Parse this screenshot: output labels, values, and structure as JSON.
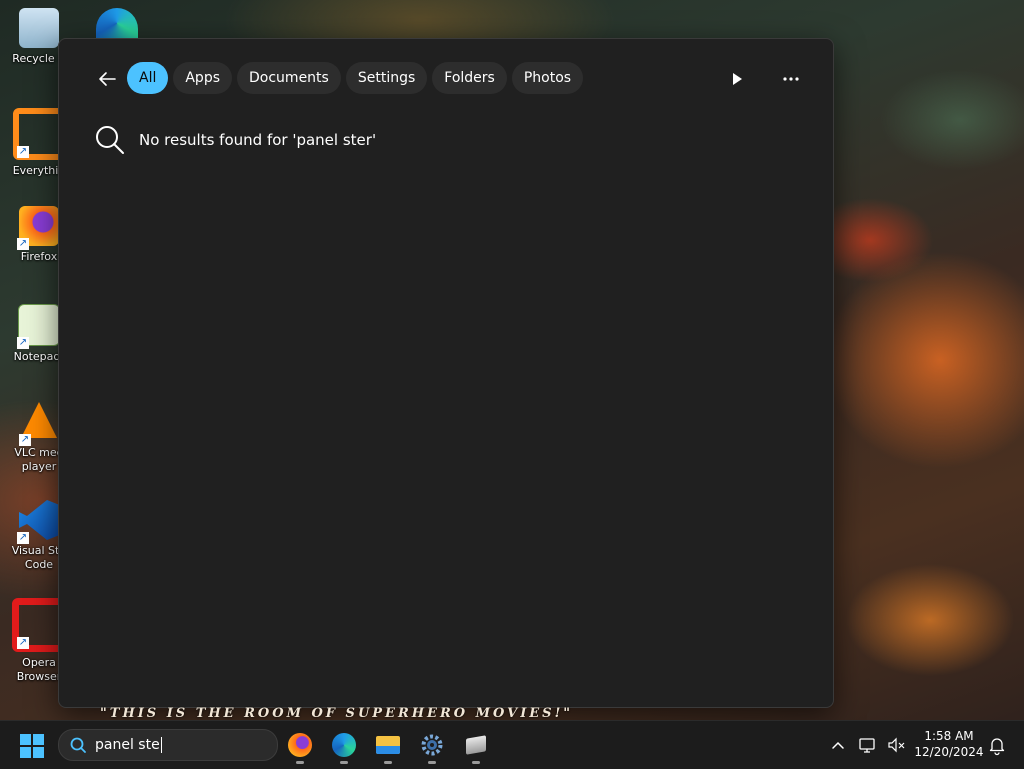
{
  "desktop": {
    "icons": [
      {
        "label": "Recycle B",
        "icon": "recycle-bin-icon"
      },
      {
        "label": "Everythin",
        "icon": "everything-search-icon"
      },
      {
        "label": "Firefox",
        "icon": "firefox-icon"
      },
      {
        "label": "Notepad-",
        "icon": "notepad-plus-plus-icon"
      },
      {
        "label": "VLC med player",
        "icon": "vlc-icon"
      },
      {
        "label": "Visual Stu Code",
        "icon": "vscode-icon"
      },
      {
        "label": "Opera Browser",
        "icon": "opera-icon"
      }
    ],
    "banner_text": "\"THIS IS THE ROOM OF SUPERHERO MOVIES!\""
  },
  "search_panel": {
    "back_icon": "back-arrow-icon",
    "filters": [
      "All",
      "Apps",
      "Documents",
      "Settings",
      "Folders",
      "Photos"
    ],
    "active_filter": "All",
    "play_icon": "play-icon",
    "more_icon": "more-options-icon",
    "no_results_text": "No results found for 'panel ster'",
    "accent_color": "#4cc2ff"
  },
  "taskbar": {
    "search_value": "panel ste",
    "apps": [
      "firefox-icon",
      "edge-icon",
      "file-explorer-icon",
      "settings-icon",
      "package-icon"
    ],
    "clock": {
      "time": "1:58 AM",
      "date": "12/20/2024"
    }
  }
}
